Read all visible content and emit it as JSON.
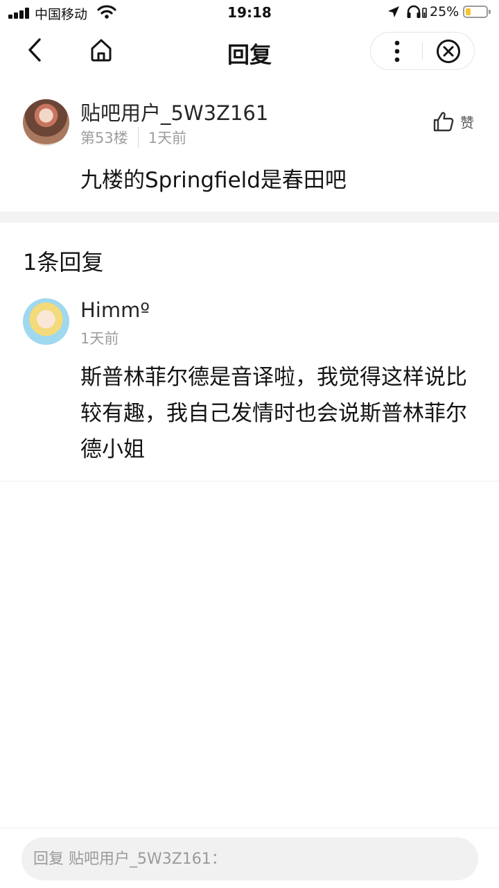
{
  "status_bar": {
    "carrier": "中国移动",
    "time": "19:18",
    "battery_percent": "25%",
    "battery_level": 0.25,
    "icons": [
      "signal-icon",
      "wifi-icon",
      "location-icon",
      "headphones-icon",
      "battery-icon"
    ]
  },
  "nav": {
    "title": "回复",
    "icons": [
      "back-icon",
      "home-icon",
      "more-icon",
      "close-icon"
    ]
  },
  "post": {
    "username": "贴吧用户_5W3Z161",
    "floor": "第53楼",
    "time": "1天前",
    "like_label": "赞",
    "content": "九楼的Springfield是春田吧"
  },
  "replies_section": {
    "count_label": "1条回复",
    "replies": [
      {
        "username": "Himmº",
        "time": "1天前",
        "content": "斯普林菲尔德是音译啦，我觉得这样说比较有趣，我自己发情时也会说斯普林菲尔德小姐"
      }
    ]
  },
  "reply_bar": {
    "placeholder": "回复 贴吧用户_5W3Z161："
  },
  "colors": {
    "battery_fill": "#f6c22d",
    "muted_text": "#9e9e9e",
    "divider_band": "#f3f3f3"
  }
}
